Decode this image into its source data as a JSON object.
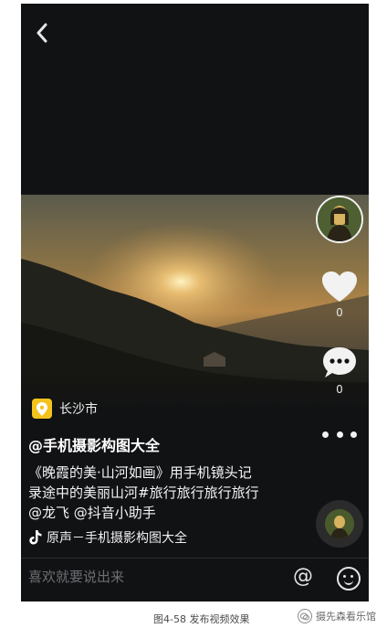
{
  "location": {
    "text": "长沙市"
  },
  "author": {
    "handle": "@手机摄影构图大全"
  },
  "caption": {
    "line1": "《晚霞的美·山河如画》用手机镜头记",
    "line2": "录途中的美丽山河#旅行旅行旅行旅行",
    "line3": "@龙飞 @抖音小助手"
  },
  "music": {
    "text": "原声－手机摄影构图大全"
  },
  "actions": {
    "like_count": "0",
    "comment_count": "0"
  },
  "comment_bar": {
    "placeholder": "喜欢就要说出来",
    "at_symbol": "@"
  },
  "figure_caption": "图4-58  发布视频效果",
  "watermark": "摄先森看乐馆",
  "icons": {
    "back": "chevron-left-icon",
    "like": "heart-icon",
    "comment": "comment-bubble-icon",
    "more": "more-dots-icon",
    "location": "location-pin-icon",
    "music": "tiktok-note-icon",
    "emoji": "emoji-icon"
  },
  "colors": {
    "location_badge": "#f4c31c",
    "background": "#111214"
  }
}
